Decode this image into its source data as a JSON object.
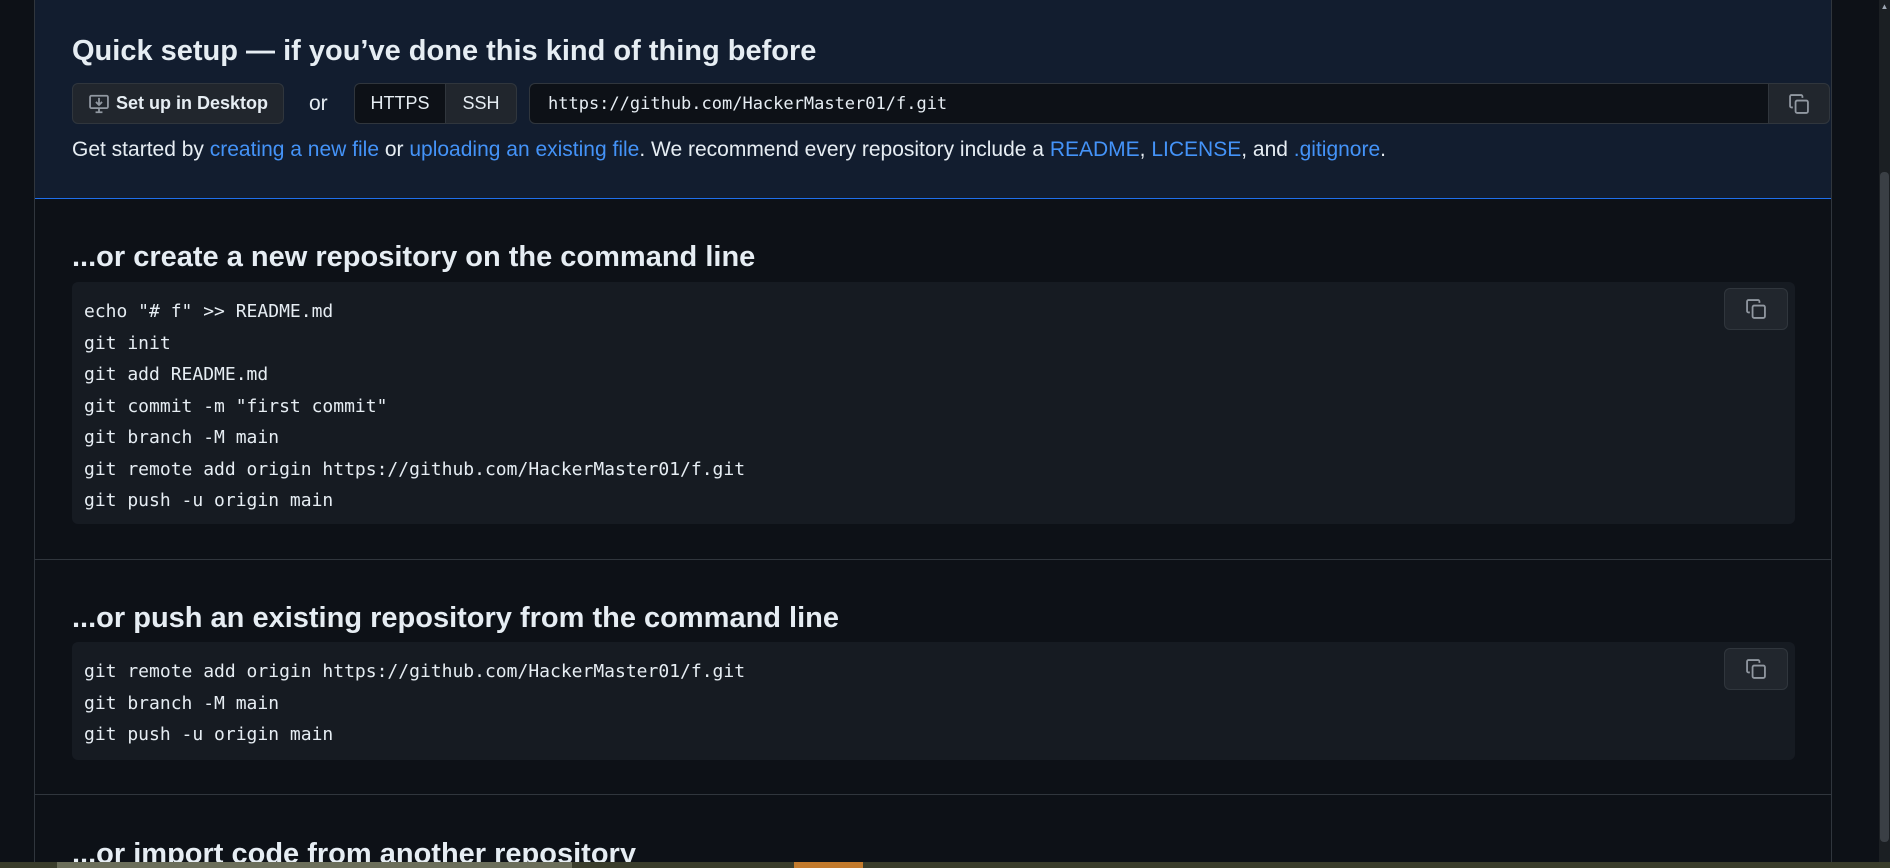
{
  "quick_setup": {
    "title": "Quick setup — if you’ve done this kind of thing before",
    "desktop_button": "Set up in Desktop",
    "or_label": "or",
    "protocols": [
      "HTTPS",
      "SSH"
    ],
    "selected_protocol": "HTTPS",
    "clone_url": "https://github.com/HackerMaster01/f.git",
    "intro": {
      "prefix": "Get started by ",
      "link_new_file": "creating a new file",
      "mid1": " or ",
      "link_upload": "uploading an existing file",
      "mid2": ". We recommend every repository include a ",
      "link_readme": "README",
      "sep1": ", ",
      "link_license": "LICENSE",
      "sep2": ", and ",
      "link_gitignore": ".gitignore",
      "suffix": "."
    }
  },
  "new_repo": {
    "title": "...or create a new repository on the command line",
    "lines": [
      "echo \"# f\" >> README.md",
      "git init",
      "git add README.md",
      "git commit -m \"first commit\"",
      "git branch -M main",
      "git remote add origin https://github.com/HackerMaster01/f.git",
      "git push -u origin main"
    ]
  },
  "push_existing": {
    "title": "...or push an existing repository from the command line",
    "lines": [
      "git remote add origin https://github.com/HackerMaster01/f.git",
      "git branch -M main",
      "git push -u origin main"
    ]
  },
  "import_code": {
    "title": "...or import code from another repository"
  },
  "icons": {
    "desktop": "desktop-download-icon",
    "copy": "copy-icon"
  },
  "colors": {
    "background": "#0d1117",
    "quick_setup_bg": "#121d2f",
    "link": "#4493f8",
    "code_bg": "#161b22",
    "border": "#30363d"
  }
}
